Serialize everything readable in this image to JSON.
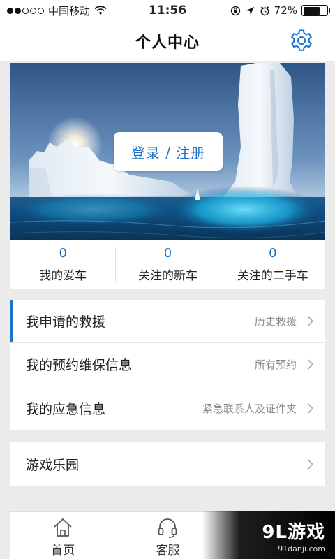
{
  "status_bar": {
    "carrier": "中国移动",
    "time": "11:56",
    "battery_percent": "72%",
    "battery_level": 0.72,
    "signal_icon": "signal-dots-icon",
    "wifi_icon": "wifi-icon"
  },
  "header": {
    "title": "个人中心",
    "settings_icon": "gear-icon"
  },
  "banner": {
    "login_label": "登录 / 注册"
  },
  "stats": [
    {
      "count": "0",
      "label": "我的爱车"
    },
    {
      "count": "0",
      "label": "关注的新车"
    },
    {
      "count": "0",
      "label": "关注的二手车"
    }
  ],
  "menu_group_1": [
    {
      "label": "我申请的救援",
      "sub": "历史救援"
    },
    {
      "label": "我的预约维保信息",
      "sub": "所有预约"
    },
    {
      "label": "我的应急信息",
      "sub": "紧急联系人及证件夹"
    }
  ],
  "menu_group_2": [
    {
      "label": "游戏乐园",
      "sub": ""
    }
  ],
  "tab_bar": [
    {
      "label": "首页",
      "icon": "home-icon"
    },
    {
      "label": "客服",
      "icon": "headset-icon"
    }
  ],
  "watermark": {
    "logo": "9L游戏",
    "url": "91danji.com"
  },
  "colors": {
    "accent": "#1c72c9",
    "background": "#ebebeb",
    "text": "#222222",
    "subtext": "#888888"
  }
}
